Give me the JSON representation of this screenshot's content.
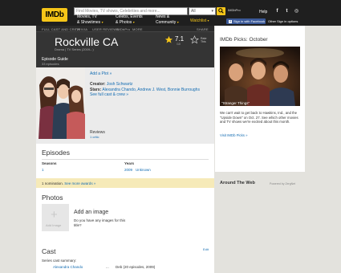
{
  "header": {
    "logo": "IMDb",
    "search_placeholder": "Find Movies, TV shows, Celebrities and more...",
    "search_category": "All",
    "nav": [
      {
        "line1": "Movies, TV",
        "line2": "& Showtimes"
      },
      {
        "line1": "Celebs, Events",
        "line2": "& Photos"
      },
      {
        "line1": "News &",
        "line2": "Community"
      }
    ],
    "watchlist": "Watchlist",
    "pro_label": "IMDbPro",
    "help": "Help",
    "facebook_signin": "Sign in with Facebook",
    "other_signin": "Other Sign in options"
  },
  "subnav": [
    "FULL CAST AND CREW",
    "TRIVIA",
    "USER REVIEWS",
    "IMDbPro",
    "MORE",
    "SHARE"
  ],
  "title": {
    "name": "Rockville CA",
    "meta": "Drama  |  TV Series (2009– )",
    "rating": "7.1",
    "rating_sub": "/10",
    "rate_label_1": "Rate",
    "rate_label_2": "This",
    "episode_guide": "Episode Guide",
    "episode_count": "33 episodes"
  },
  "details": {
    "plot_link": "Add a Plot »",
    "creator_label": "Creator:",
    "creator": "Josh Schwartz",
    "stars_label": "Stars:",
    "stars": "Alexandra Chando, Andrew J. West, Bonnie Burroughs",
    "cast_link": "See full cast & crew »",
    "reviews_label": "Reviews",
    "reviews_sub": "1 critic"
  },
  "episodes": {
    "title": "Episodes",
    "seasons_label": "Seasons",
    "seasons": "1",
    "years_label": "Years",
    "years": [
      "2009",
      "Unknown"
    ]
  },
  "awards": {
    "text": "1 nomination.",
    "link": "See more awards »"
  },
  "photos": {
    "title": "Photos",
    "box_label": "Add Image",
    "add_title": "Add an image",
    "add_question": "Do you have any images for this title?"
  },
  "cast": {
    "title": "Cast",
    "edit": "Edit",
    "summary": "Series cast summary:",
    "rows": [
      {
        "name": "Alexandra Chando",
        "dots": "...",
        "role": "Deb (20 episodes, 2009)"
      }
    ]
  },
  "sidebar": {
    "picks_title": "IMDb Picks: October",
    "picks_caption": "\"Stranger Things\"",
    "picks_desc": "We can't wait to get back to Hawkins, Ind., and the \"Upside Down\" on Oct. 27. See which other movies and TV shows we're excited about this month.",
    "picks_link": "Visit IMDb Picks »",
    "around_web": "Around The Web",
    "powered": "Powered by ZergNet"
  },
  "colors": {
    "imdb_yellow": "#f5c518",
    "header_bg": "#1f1f1f",
    "link_blue": "#136cb2",
    "section_gold": "#a58500",
    "awards_bg": "#f6eab8"
  }
}
